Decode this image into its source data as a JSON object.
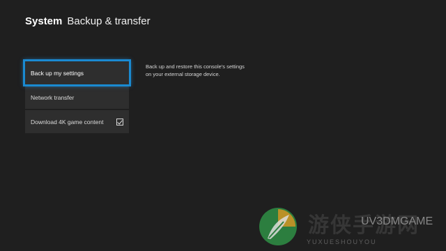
{
  "header": {
    "section": "System",
    "page": "Backup & transfer"
  },
  "menu": {
    "items": [
      {
        "label": "Back up my settings",
        "focused": true
      },
      {
        "label": "Network transfer",
        "focused": false
      },
      {
        "label": "Download 4K game content",
        "focused": false,
        "checkbox": "checked"
      }
    ]
  },
  "description": "Back up and restore this console's settings on your external storage device.",
  "watermark": {
    "cn": "游侠手游网",
    "en": "YUXUESHOUYOU",
    "site": "UV3DMGAME",
    "icon": "feather-leaf-logo"
  },
  "colors": {
    "background": "#1f1f1f",
    "tile": "#2e2e2e",
    "focus": "#1a8ad1",
    "text": "#e6e6e6",
    "logo": "#1f7a3a"
  }
}
